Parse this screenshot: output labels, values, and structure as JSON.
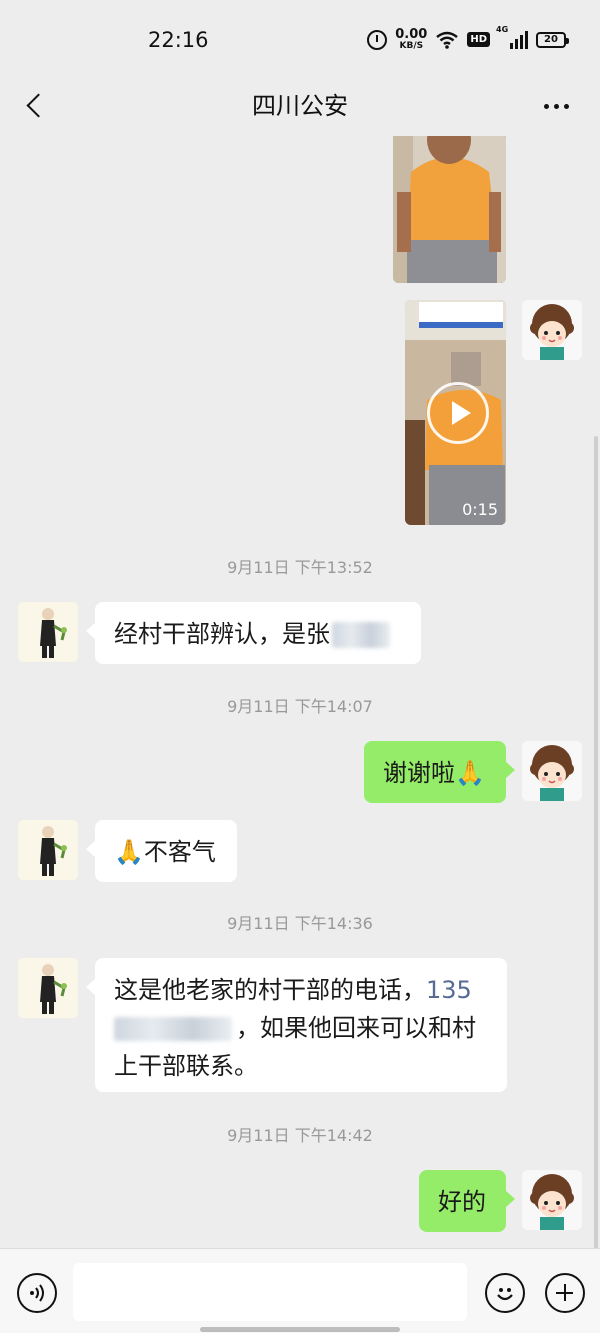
{
  "status_bar": {
    "time": "22:16",
    "net_speed_value": "0.00",
    "net_speed_unit": "KB/S",
    "hd_label": "HD",
    "signal_label": "4G",
    "battery_level": "20"
  },
  "header": {
    "title": "四川公安",
    "back_icon": "chevron-left-icon",
    "more_icon": "more-dots-icon"
  },
  "messages": [
    {
      "type": "image",
      "sender": "me"
    },
    {
      "type": "video",
      "sender": "me",
      "duration": "0:15"
    },
    {
      "type": "timestamp",
      "text": "9月11日 下午13:52"
    },
    {
      "type": "text",
      "sender": "police",
      "text": "经村干部辨认，是张"
    },
    {
      "type": "timestamp",
      "text": "9月11日 下午14:07"
    },
    {
      "type": "text",
      "sender": "me",
      "text": "谢谢啦🙏"
    },
    {
      "type": "text",
      "sender": "police",
      "text": "🙏不客气"
    },
    {
      "type": "timestamp",
      "text": "9月11日 下午14:36"
    },
    {
      "type": "text",
      "sender": "police",
      "text_before": "这是他老家的村干部的电话，",
      "phone_prefix": "135",
      "text_after": "，如果他回来可以和村上干部联系。"
    },
    {
      "type": "timestamp",
      "text": "9月11日 下午14:42"
    },
    {
      "type": "text",
      "sender": "me",
      "text": "好的"
    }
  ],
  "input_bar": {
    "voice_icon": "voice-icon",
    "input_value": "",
    "emoji_icon": "emoji-icon",
    "plus_icon": "plus-icon"
  },
  "colors": {
    "background": "#ededed",
    "outgoing_bubble": "#95ec69",
    "incoming_bubble": "#ffffff",
    "link": "#576b95"
  }
}
